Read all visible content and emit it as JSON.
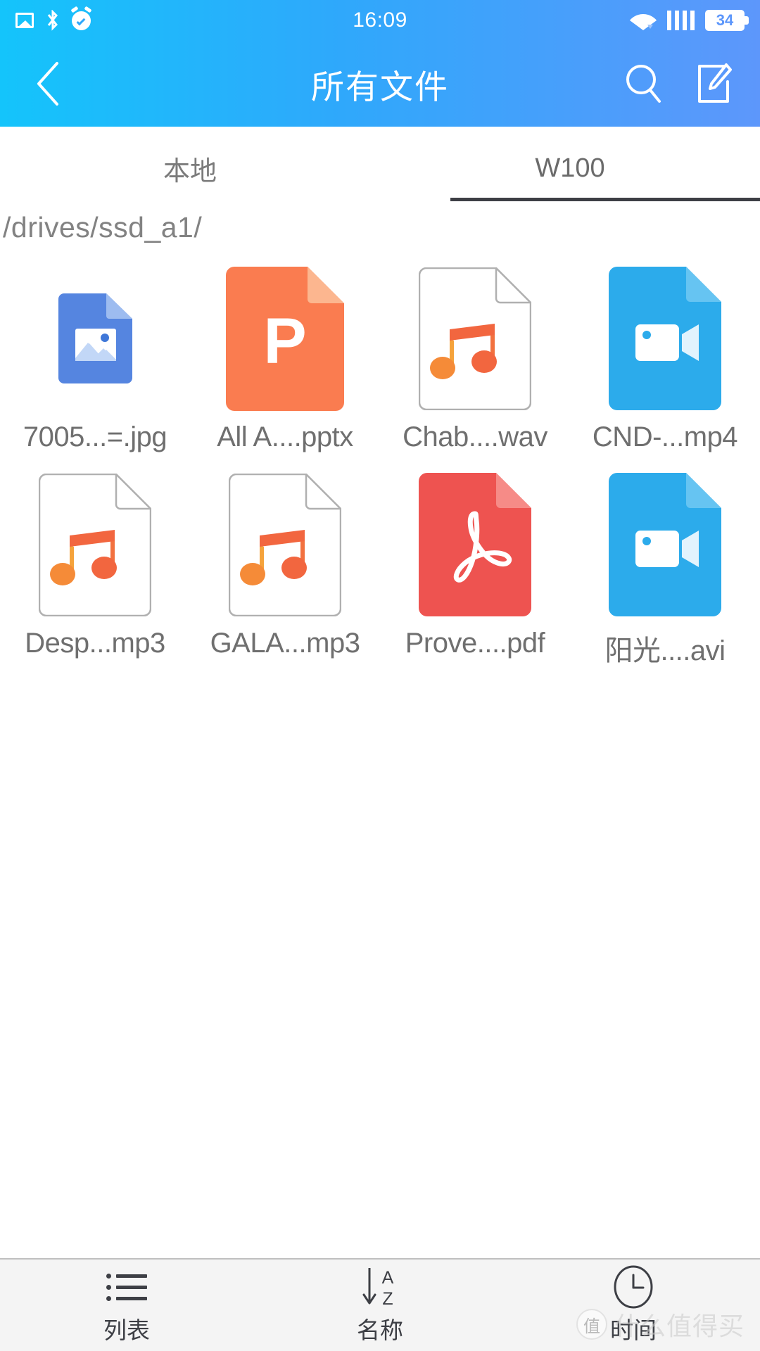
{
  "status_bar": {
    "time": "16:09",
    "battery_level": "34",
    "left_icons": [
      "image-icon",
      "bluetooth-icon",
      "alarm-clock-icon"
    ],
    "right_icons": [
      "wifi-icon",
      "signal-bars-icon",
      "battery-icon"
    ]
  },
  "header": {
    "title": "所有文件",
    "back_icon": "chevron-left-icon",
    "search_icon": "search-icon",
    "compose_icon": "compose-icon"
  },
  "tabs": [
    {
      "label": "本地",
      "active": false
    },
    {
      "label": "W100",
      "active": true
    }
  ],
  "path": "/drives/ssd_a1/",
  "files": [
    {
      "name": "7005...=.jpg",
      "type": "image",
      "icon": "image-file-icon"
    },
    {
      "name": "All A....pptx",
      "type": "pptx",
      "icon": "powerpoint-file-icon"
    },
    {
      "name": "Chab....wav",
      "type": "wav",
      "icon": "audio-file-icon"
    },
    {
      "name": "CND-...mp4",
      "type": "mp4",
      "icon": "video-file-icon"
    },
    {
      "name": "Desp...mp3",
      "type": "mp3",
      "icon": "audio-file-icon"
    },
    {
      "name": "GALA...mp3",
      "type": "mp3",
      "icon": "audio-file-icon"
    },
    {
      "name": "Prove....pdf",
      "type": "pdf",
      "icon": "pdf-file-icon"
    },
    {
      "name": "阳光....avi",
      "type": "avi",
      "icon": "video-file-icon"
    }
  ],
  "bottom_bar": [
    {
      "label": "列表",
      "icon": "list-view-icon"
    },
    {
      "label": "名称",
      "icon": "sort-az-icon"
    },
    {
      "label": "时间",
      "icon": "clock-icon"
    }
  ],
  "watermark": {
    "text": "什么值得买",
    "logo_text": "值"
  },
  "colors": {
    "header_gradient_start": "#14c4fb",
    "header_gradient_end": "#5d97fb",
    "tab_indicator": "#3d3f45",
    "text_gray": "#6f6f6f",
    "pptx_orange": "#fa7c50",
    "pdf_red": "#ee5350",
    "video_blue": "#2cabeb",
    "image_blue": "#5585e0",
    "audio_orange": "#f47b45"
  }
}
